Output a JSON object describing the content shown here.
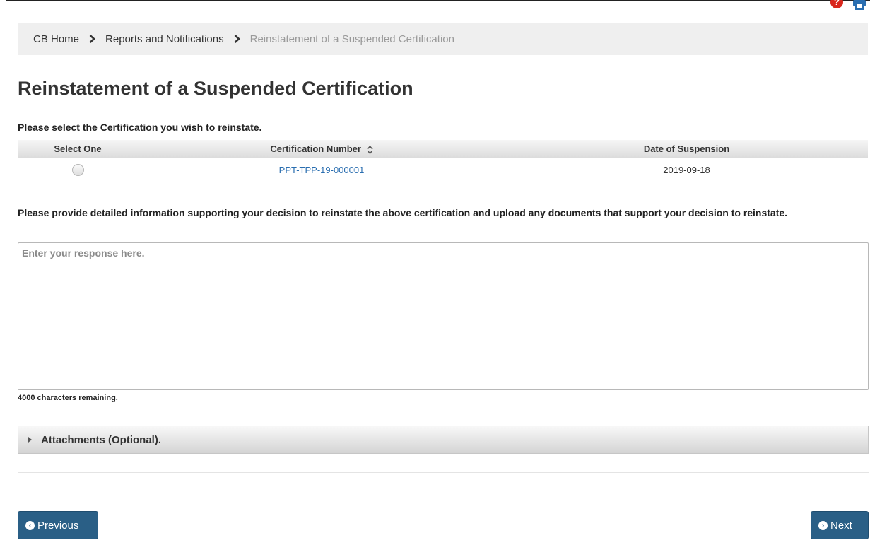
{
  "toolbar": {
    "help_icon": "help-icon",
    "print_icon": "print-icon"
  },
  "breadcrumb": {
    "items": [
      "CB Home",
      "Reports and Notifications",
      "Reinstatement of a Suspended Certification"
    ]
  },
  "page": {
    "title": "Reinstatement of a Suspended Certification",
    "instruction": "Please select the Certification you wish to reinstate."
  },
  "table": {
    "headers": [
      "Select One",
      "Certification Number",
      "Date of Suspension"
    ],
    "rows": [
      {
        "certification_number": "PPT-TPP-19-000001",
        "date_of_suspension": "2019-09-18"
      }
    ]
  },
  "details": {
    "prompt": "Please provide detailed information supporting your decision to reinstate the above certification and upload any documents that support your decision to reinstate.",
    "placeholder": "Enter your response here.",
    "chars_remaining": "4000 characters remaining."
  },
  "attachments": {
    "label": "Attachments (Optional)."
  },
  "nav": {
    "previous_label": "Previous",
    "next_label": "Next"
  },
  "colors": {
    "accent": "#2a5f86",
    "link": "#2a6eb0",
    "help": "#d9271d"
  }
}
